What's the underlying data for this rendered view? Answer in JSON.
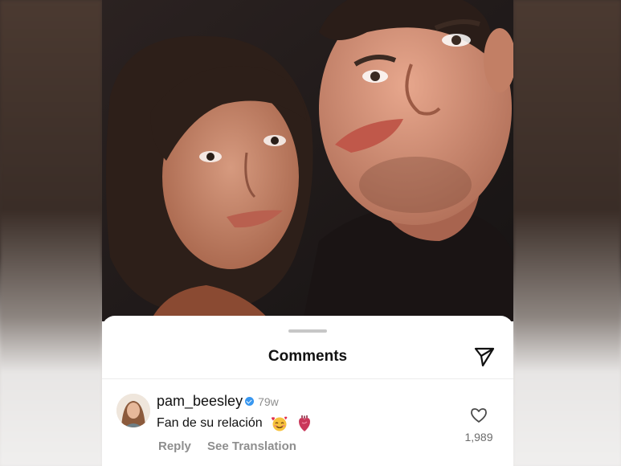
{
  "comments_sheet": {
    "title": "Comments"
  },
  "comment": {
    "username": "pam_beesley",
    "verified": true,
    "time": "79w",
    "text": "Fan de su relación",
    "emojis": [
      "smiling-face-with-hearts-emoji",
      "anatomical-heart-emoji"
    ],
    "reply_label": "Reply",
    "translation_label": "See Translation",
    "like_count": "1,989"
  },
  "icons": {
    "share": "paper-plane-icon",
    "like": "heart-outline-icon",
    "verified": "verified-badge-icon"
  },
  "colors": {
    "verified": "#3897f0",
    "secondary_text": "#8e8e8e",
    "primary_text": "#111111",
    "sheet_background": "#ffffff"
  }
}
